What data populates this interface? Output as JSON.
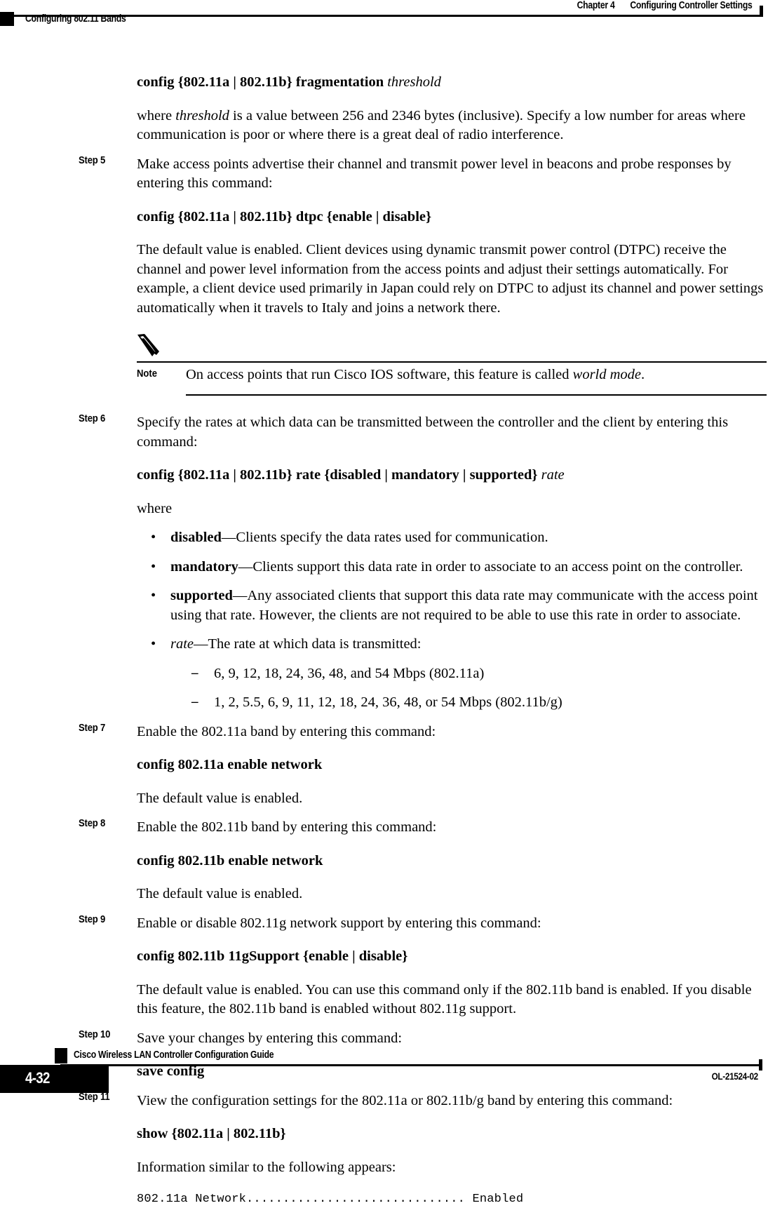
{
  "header": {
    "chapter": "Chapter 4",
    "chapter_title": "Configuring Controller Settings",
    "section_title": "Configuring 802.11 Bands"
  },
  "footer": {
    "guide_title": "Cisco Wireless LAN Controller Configuration Guide",
    "page_number": "4-32",
    "doc_id": "OL-21524-02"
  },
  "body": {
    "frag_command": {
      "config": "config",
      "bands": "{802.11a | 802.11b}",
      "keyword": "fragmentation",
      "arg": "threshold"
    },
    "frag_where": {
      "pre": "where ",
      "italic": "threshold",
      "post": " is a value between 256 and 2346 bytes (inclusive). Specify a low number for areas where communication is poor or where there is a great deal of radio interference."
    },
    "step5": {
      "label": "Step 5",
      "text": "Make access points advertise their channel and transmit power level in beacons and probe responses by entering this command:",
      "command": "config {802.11a | 802.11b} dtpc {enable | disable}",
      "description": "The default value is enabled. Client devices using dynamic transmit power control (DTPC) receive the channel and power level information from the access points and adjust their settings automatically. For example, a client device used primarily in Japan could rely on DTPC to adjust its channel and power settings automatically when it travels to Italy and joins a network there."
    },
    "note": {
      "icon": "pencil-note-icon",
      "label": "Note",
      "text_pre": "On access points that run Cisco IOS software, this feature is called ",
      "text_italic": "world mode",
      "text_post": "."
    },
    "step6": {
      "label": "Step 6",
      "text": "Specify the rates at which data can be transmitted between the controller and the client by entering this command:",
      "command": "config {802.11a | 802.11b} rate {disabled | mandatory | supported} rate",
      "command_arg_italic": "rate",
      "where": "where",
      "bullets": [
        {
          "term": "disabled",
          "term_italic": false,
          "text": "—Clients specify the data rates used for communication."
        },
        {
          "term": "mandatory",
          "term_italic": false,
          "text": "—Clients support this data rate in order to associate to an access point on the controller."
        },
        {
          "term": "supported",
          "term_italic": false,
          "text": "—Any associated clients that support this data rate may communicate with the access point using that rate. However, the clients are not required to be able to use this rate in order to associate."
        },
        {
          "term": "rate",
          "term_italic": true,
          "text": "—The rate at which data is transmitted:"
        }
      ],
      "sub_items": [
        "6, 9, 12, 18, 24, 36, 48, and 54 Mbps (802.11a)",
        "1, 2, 5.5, 6, 9, 11, 12, 18, 24, 36, 48, or 54 Mbps (802.11b/g)"
      ]
    },
    "step7": {
      "label": "Step 7",
      "text": "Enable the 802.11a band by entering this command:",
      "command": "config 802.11a enable network",
      "description": "The default value is enabled."
    },
    "step8": {
      "label": "Step 8",
      "text": "Enable the 802.11b band by entering this command:",
      "command": "config 802.11b enable network",
      "description": "The default value is enabled."
    },
    "step9": {
      "label": "Step 9",
      "text": "Enable or disable 802.11g network support by entering this command:",
      "command": "config 802.11b 11gSupport {enable | disable}",
      "description": "The default value is enabled. You can use this command only if the 802.11b band is enabled. If you disable this feature, the 802.11b band is enabled without 802.11g support."
    },
    "step10": {
      "label": "Step 10",
      "text": "Save your changes by entering this command:",
      "command": "save config"
    },
    "step11": {
      "label": "Step 11",
      "text": "View the configuration settings for the 802.11a or 802.11b/g band by entering this command:",
      "command": "show {802.11a | 802.11b}",
      "description": "Information similar to the following appears:",
      "cli_output": "802.11a Network.............................. Enabled"
    }
  }
}
